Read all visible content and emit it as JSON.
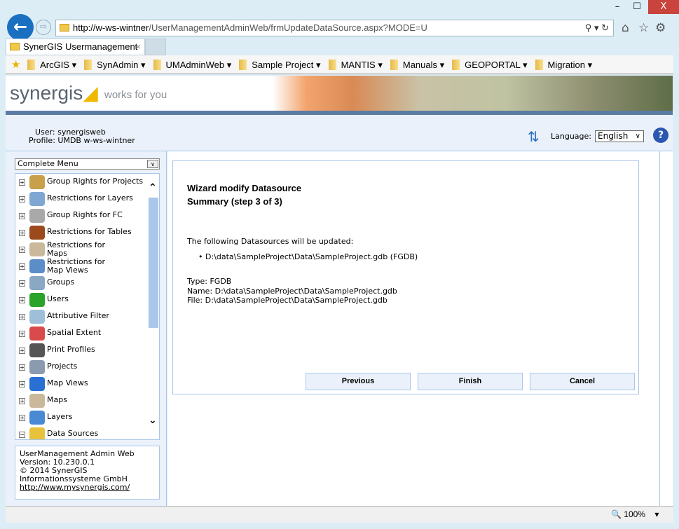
{
  "browser": {
    "url_host": "http://w-ws-wintner",
    "url_path": "/UserManagementAdminWeb/frmUpdateDataSource.aspx?MODE=U",
    "tab_title": "SynerGIS Usermanagement ...",
    "favorites": [
      "ArcGIS",
      "SynAdmin",
      "UMAdminWeb",
      "Sample Project",
      "MANTIS",
      "Manuals",
      "GEOPORTAL",
      "Migration"
    ],
    "zoom_level": "100%"
  },
  "header": {
    "logo": "synergis",
    "slogan": "works for you",
    "user_line": "User: synergisweb",
    "profile_line": "Profile: UMDB w-ws-wintner",
    "language_label": "Language:",
    "language_value": "English"
  },
  "sidebar": {
    "menu_select": "Complete Menu",
    "items": [
      {
        "label": "Group Rights for Projects",
        "color": "#c9a04a"
      },
      {
        "label": "Restrictions for Layers",
        "color": "#7fa7d4"
      },
      {
        "label": "Group Rights for FC",
        "color": "#a9a9a9"
      },
      {
        "label": "Restrictions for Tables",
        "color": "#9c4a1c"
      },
      {
        "label": "Restrictions for Maps",
        "color": "#c9b99a"
      },
      {
        "label": "Restrictions for Map Views",
        "color": "#5b8ec9"
      },
      {
        "label": "Groups",
        "color": "#8aa7c4"
      },
      {
        "label": "Users",
        "color": "#2aa32a"
      },
      {
        "label": "Attributive Filter",
        "color": "#9fbfd9"
      },
      {
        "label": "Spatial Extent",
        "color": "#d94a4a"
      },
      {
        "label": "Print Profiles",
        "color": "#555555"
      },
      {
        "label": "Projects",
        "color": "#8a9bb0"
      },
      {
        "label": "Map Views",
        "color": "#2a6fd4"
      },
      {
        "label": "Maps",
        "color": "#c9b99a"
      },
      {
        "label": "Layers",
        "color": "#4a8ad4"
      },
      {
        "label": "Data Sources",
        "color": "#e8c23a"
      }
    ],
    "about": {
      "line1": "UserManagement Admin Web",
      "line2": "Version: 10.230.0.1",
      "line3": "© 2014 SynerGIS",
      "line4": "Informationssysteme GmbH",
      "link": "http://www.mysynergis.com/"
    }
  },
  "wizard": {
    "title": "Wizard modify Datasource",
    "step": "Summary (step 3 of 3)",
    "intro": "The following Datasources will be updated:",
    "list_item": "D:\\data\\SampleProject\\Data\\SampleProject.gdb (FGDB)",
    "type": "Type: FGDB",
    "name": "Name: D:\\data\\SampleProject\\Data\\SampleProject.gdb",
    "file": "File: D:\\data\\SampleProject\\Data\\SampleProject.gdb",
    "previous": "Previous",
    "finish": "Finish",
    "cancel": "Cancel"
  }
}
